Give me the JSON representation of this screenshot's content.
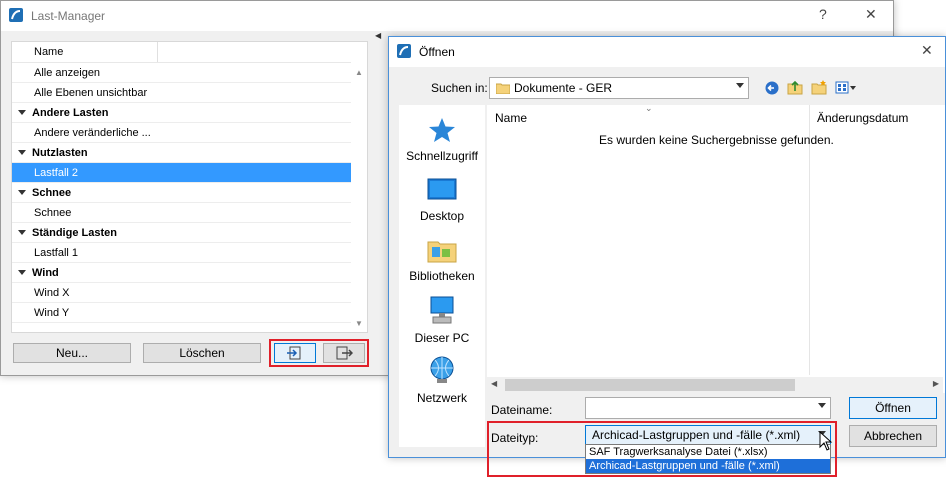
{
  "last_manager": {
    "title": "Last-Manager",
    "help": "?",
    "close": "✕",
    "column_name": "Name",
    "rows": [
      {
        "type": "item",
        "label": "Alle anzeigen"
      },
      {
        "type": "item",
        "label": "Alle Ebenen unsichtbar"
      },
      {
        "type": "group",
        "label": "Andere Lasten"
      },
      {
        "type": "item",
        "label": "Andere veränderliche ..."
      },
      {
        "type": "group",
        "label": "Nutzlasten"
      },
      {
        "type": "item",
        "label": "Lastfall 2",
        "selected": true
      },
      {
        "type": "group",
        "label": "Schnee"
      },
      {
        "type": "item",
        "label": "Schnee"
      },
      {
        "type": "group",
        "label": "Ständige Lasten"
      },
      {
        "type": "item",
        "label": "Lastfall 1"
      },
      {
        "type": "group",
        "label": "Wind"
      },
      {
        "type": "item",
        "label": "Wind X"
      },
      {
        "type": "item",
        "label": "Wind Y"
      }
    ],
    "new_button": "Neu...",
    "delete_button": "Löschen"
  },
  "open_dialog": {
    "title": "Öffnen",
    "close": "✕",
    "look_in_label": "Suchen in:",
    "look_in_value": "Dokumente - GER",
    "places": [
      "Schnellzugriff",
      "Desktop",
      "Bibliotheken",
      "Dieser PC",
      "Netzwerk"
    ],
    "col_name": "Name",
    "col_date": "Änderungsdatum",
    "empty_message": "Es wurden keine Suchergebnisse gefunden.",
    "filename_label": "Dateiname:",
    "filename_value": "",
    "filetype_label": "Dateityp:",
    "filetype_value": "Archicad-Lastgruppen und -fälle (*.xml)",
    "filetype_options": [
      "SAF Tragwerksanalyse Datei (*.xlsx)",
      "Archicad-Lastgruppen und -fälle (*.xml)"
    ],
    "open_button": "Öffnen",
    "cancel_button": "Abbrechen"
  },
  "colors": {
    "selection": "#3399ff",
    "highlight_box": "#e0202a",
    "dropdown_highlight": "#1e6fd9"
  }
}
